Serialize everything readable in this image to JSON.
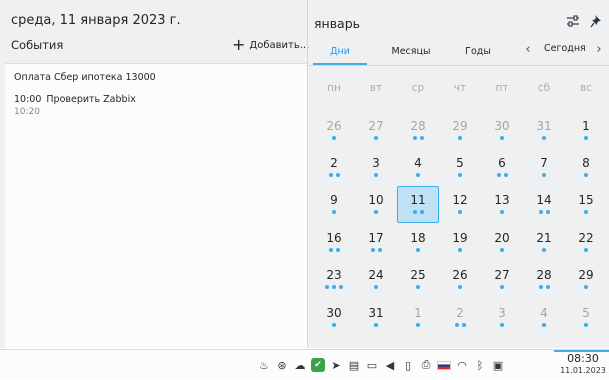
{
  "agenda": {
    "date_title": "среда, 11 января 2023 г.",
    "events_label": "События",
    "add_label": "Добавить...",
    "all_day_event": "Оплата Сбер ипотека 13000",
    "timed_event": {
      "start": "10:00",
      "title": "Проверить Zabbix",
      "end": "10:20"
    }
  },
  "calendar": {
    "month": "январь",
    "tabs": [
      "Дни",
      "Месяцы",
      "Годы"
    ],
    "active_tab": "Дни",
    "today_label": "Сегодня",
    "weekdays": [
      "пн",
      "вт",
      "ср",
      "чт",
      "пт",
      "сб",
      "вс"
    ],
    "weeks": [
      [
        {
          "d": "26",
          "other": true,
          "dots": 1
        },
        {
          "d": "27",
          "other": true,
          "dots": 1
        },
        {
          "d": "28",
          "other": true,
          "dots": 2
        },
        {
          "d": "29",
          "other": true,
          "dots": 1
        },
        {
          "d": "30",
          "other": true,
          "dots": 1
        },
        {
          "d": "31",
          "other": true,
          "dots": 1
        },
        {
          "d": "1",
          "other": false,
          "dots": 1
        }
      ],
      [
        {
          "d": "2",
          "other": false,
          "dots": 2
        },
        {
          "d": "3",
          "other": false,
          "dots": 1
        },
        {
          "d": "4",
          "other": false,
          "dots": 1
        },
        {
          "d": "5",
          "other": false,
          "dots": 1
        },
        {
          "d": "6",
          "other": false,
          "dots": 2
        },
        {
          "d": "7",
          "other": false,
          "dots": 1
        },
        {
          "d": "8",
          "other": false,
          "dots": 1
        }
      ],
      [
        {
          "d": "9",
          "other": false,
          "dots": 1
        },
        {
          "d": "10",
          "other": false,
          "dots": 1
        },
        {
          "d": "11",
          "other": false,
          "dots": 2,
          "today": true
        },
        {
          "d": "12",
          "other": false,
          "dots": 1
        },
        {
          "d": "13",
          "other": false,
          "dots": 1
        },
        {
          "d": "14",
          "other": false,
          "dots": 2
        },
        {
          "d": "15",
          "other": false,
          "dots": 1
        }
      ],
      [
        {
          "d": "16",
          "other": false,
          "dots": 2
        },
        {
          "d": "17",
          "other": false,
          "dots": 2
        },
        {
          "d": "18",
          "other": false,
          "dots": 1
        },
        {
          "d": "19",
          "other": false,
          "dots": 1
        },
        {
          "d": "20",
          "other": false,
          "dots": 1
        },
        {
          "d": "21",
          "other": false,
          "dots": 1
        },
        {
          "d": "22",
          "other": false,
          "dots": 1
        }
      ],
      [
        {
          "d": "23",
          "other": false,
          "dots": 3
        },
        {
          "d": "24",
          "other": false,
          "dots": 1
        },
        {
          "d": "25",
          "other": false,
          "dots": 1
        },
        {
          "d": "26",
          "other": false,
          "dots": 1
        },
        {
          "d": "27",
          "other": false,
          "dots": 1
        },
        {
          "d": "28",
          "other": false,
          "dots": 2
        },
        {
          "d": "29",
          "other": false,
          "dots": 1
        }
      ],
      [
        {
          "d": "30",
          "other": false,
          "dots": 1
        },
        {
          "d": "31",
          "other": false,
          "dots": 1
        },
        {
          "d": "1",
          "other": true,
          "dots": 1
        },
        {
          "d": "2",
          "other": true,
          "dots": 2
        },
        {
          "d": "3",
          "other": true,
          "dots": 1
        },
        {
          "d": "4",
          "other": true,
          "dots": 1
        },
        {
          "d": "5",
          "other": true,
          "dots": 1
        }
      ]
    ]
  },
  "taskbar": {
    "tray_icons": [
      "notifications-icon",
      "updates-icon",
      "cloud-icon",
      "green-app-icon",
      "telegram-icon",
      "clipboard-icon",
      "battery-icon",
      "volume-icon",
      "usb-icon",
      "printer-icon",
      "keyboard-layout-flag-icon",
      "wifi-icon",
      "bluetooth-icon",
      "screen-icon"
    ],
    "clock_time": "08:30",
    "clock_date": "11.01.2023"
  },
  "colors": {
    "accent": "#3daee9",
    "today_fill": "#bfe0f5",
    "background": "#eff0f1"
  }
}
